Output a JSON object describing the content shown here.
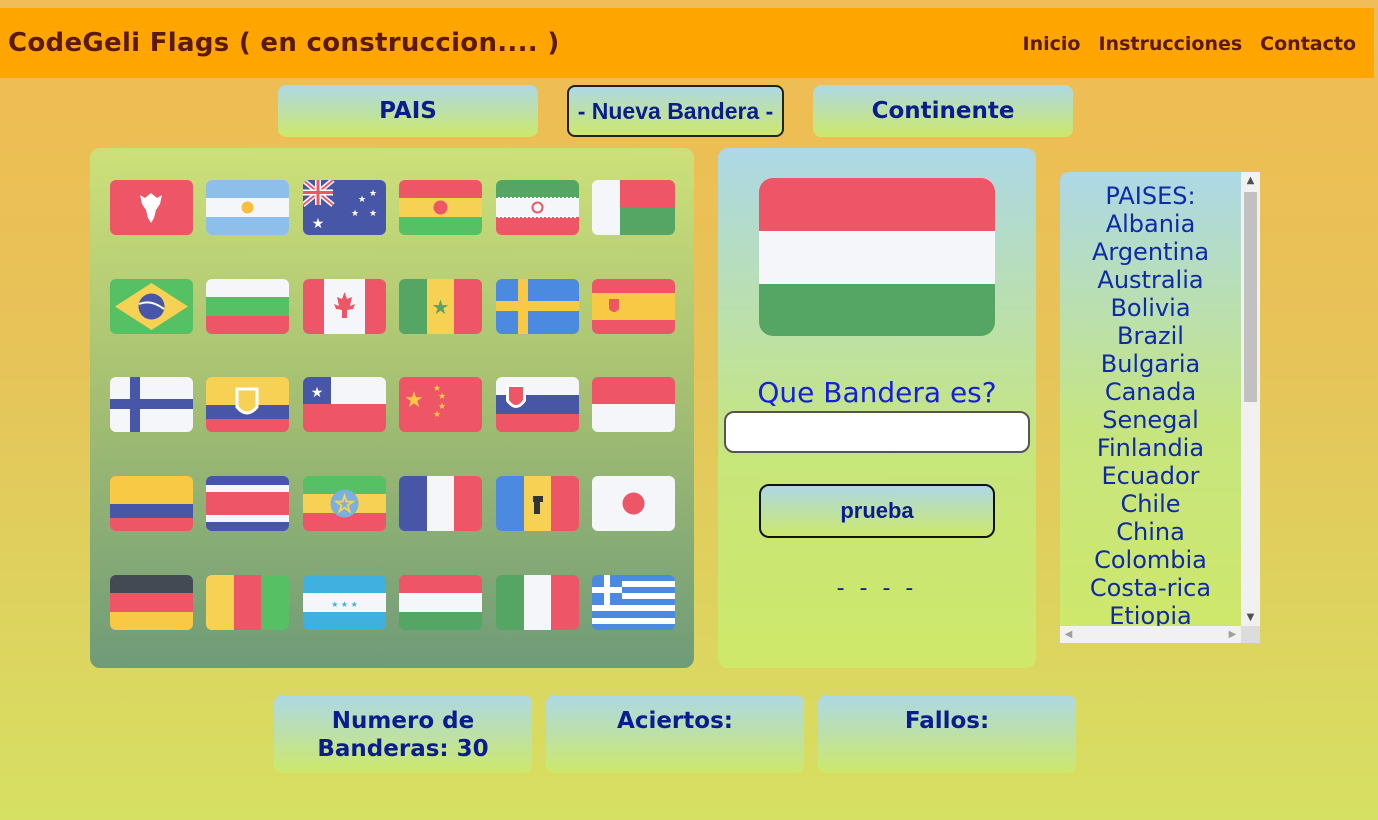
{
  "header": {
    "title": "CodeGeli Flags ( en construccion.... )",
    "nav": [
      "Inicio",
      "Instrucciones",
      "Contacto"
    ]
  },
  "modes": {
    "pais": "PAIS",
    "nueva": "- Nueva Bandera -",
    "continente": "Continente"
  },
  "flags": [
    "albania-flag",
    "argentina-flag",
    "australia-flag",
    "bolivia-flag",
    "iran-flag",
    "madagascar-flag",
    "brazil-flag",
    "bulgaria-flag",
    "canada-flag",
    "senegal-flag",
    "sweden-flag",
    "spain-flag",
    "finland-flag",
    "ecuador-flag",
    "chile-flag",
    "china-flag",
    "slovenia-flag",
    "indonesia-flag",
    "colombia-flag",
    "costa-rica-flag",
    "ethiopia-flag",
    "france-flag",
    "andorra-flag",
    "japan-flag",
    "germany-flag",
    "guinea-flag",
    "honduras-flag",
    "hungary-flag",
    "italy-flag",
    "greece-flag"
  ],
  "quiz": {
    "current_flag": "hungary-flag",
    "question": "Que Bandera es?",
    "answer_value": "",
    "button": "prueba",
    "result": "- - - -"
  },
  "list": {
    "heading": "PAISES:",
    "items": [
      "Albania",
      "Argentina",
      "Australia",
      "Bolivia",
      "Brazil",
      "Bulgaria",
      "Canada",
      "Senegal",
      "Finlandia",
      "Ecuador",
      "Chile",
      "China",
      "Colombia",
      "Costa-rica",
      "Etiopia"
    ]
  },
  "stats": {
    "numero": "Numero de Banderas: 30",
    "aciertos": "Aciertos:",
    "fallos": "Fallos:"
  },
  "colors": {
    "header_bg": "#ffa500",
    "brand_text": "#5a1a10",
    "accent_text": "#0a1d8f"
  }
}
